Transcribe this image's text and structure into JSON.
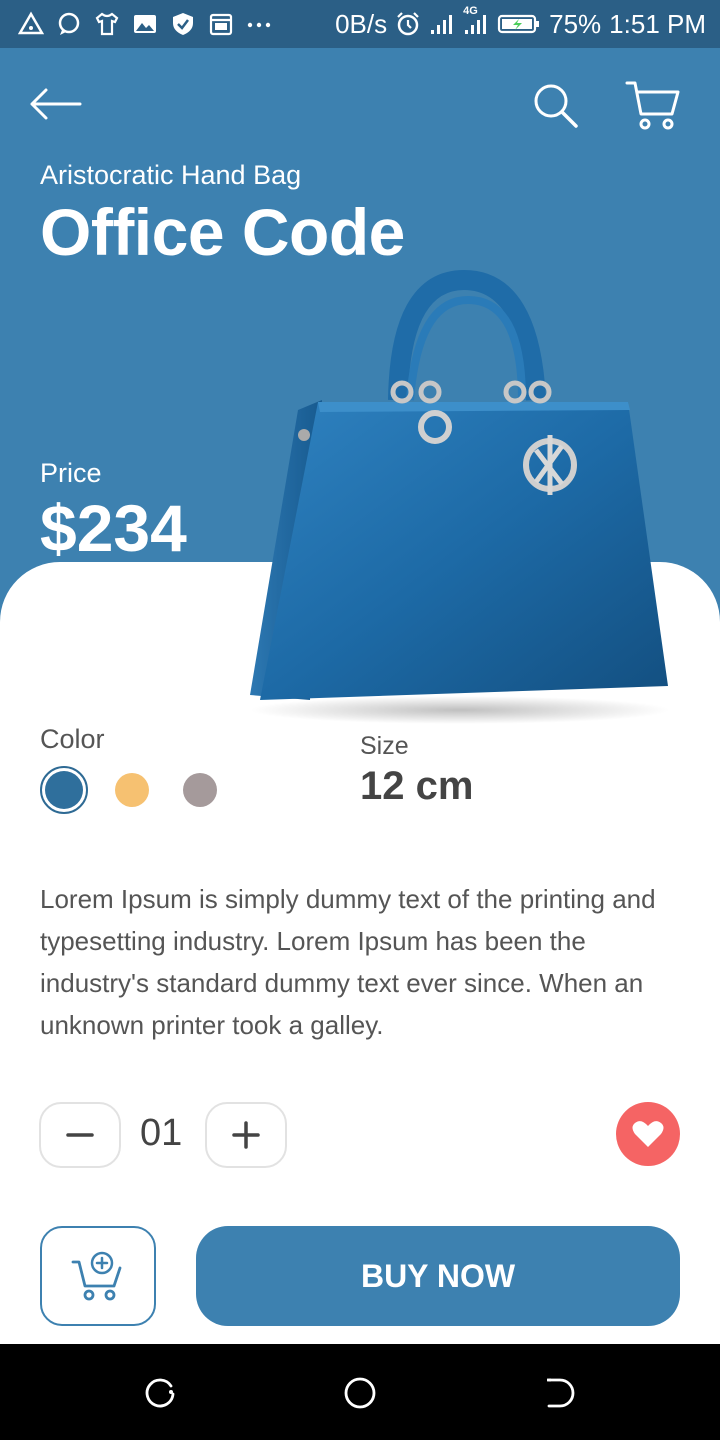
{
  "status_bar": {
    "speed": "0B/s",
    "network_badge": "4G",
    "battery": "75%",
    "time": "1:51 PM",
    "icons": [
      "warning-icon",
      "chat-icon",
      "shirt-icon",
      "image-icon",
      "shield-icon",
      "calendar-icon",
      "more-icon",
      "alarm-icon",
      "signal-icon",
      "signal-4g-icon",
      "battery-icon"
    ]
  },
  "header": {
    "back_icon": "arrow-left-icon",
    "search_icon": "search-icon",
    "cart_icon": "cart-icon"
  },
  "product": {
    "subtitle": "Aristocratic Hand Bag",
    "title": "Office Code",
    "price_label": "Price",
    "price": "$234",
    "color_label": "Color",
    "colors": [
      "#2f6f9c",
      "#f6c171",
      "#a59a9b"
    ],
    "selected_color_index": 0,
    "size_label": "Size",
    "size": "12 cm",
    "description": "Lorem Ipsum is simply dummy text of the printing and typesetting industry. Lorem Ipsum has been the industry's standard dummy text ever since. When an unknown printer took a galley."
  },
  "quantity": {
    "value": "01",
    "minus_icon": "minus-icon",
    "plus_icon": "plus-icon"
  },
  "actions": {
    "favorite_icon": "heart-icon",
    "add_to_cart_icon": "cart-add-icon",
    "buy_label": "BUY NOW"
  },
  "colors": {
    "primary": "#3d81b0",
    "status_bar": "#2b5f86",
    "favorite": "#f56464",
    "text": "#555555"
  },
  "nav_bar": {
    "icons": [
      "recents-icon",
      "home-icon",
      "back-icon"
    ]
  }
}
